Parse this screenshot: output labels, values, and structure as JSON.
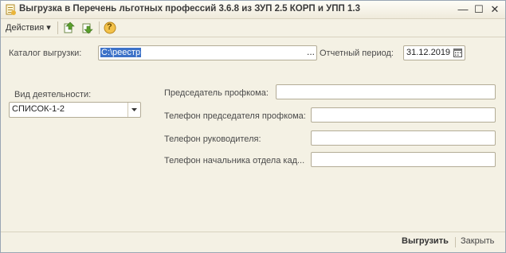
{
  "window": {
    "title": "Выгрузка в Перечень льготных профессий 3.6.8 из ЗУП 2.5 КОРП и УПП 1.3",
    "minimize_glyph": "—",
    "maximize_glyph": "☐",
    "close_glyph": "✕"
  },
  "toolbar": {
    "actions_label": "Действия",
    "actions_arrow": "▾",
    "help_glyph": "?"
  },
  "form": {
    "catalog_label": "Каталог выгрузки:",
    "catalog_value": "C:\\реестр",
    "catalog_browse": "...",
    "period_label": "Отчетный период:",
    "period_value": "31.12.2019",
    "activity_label": "Вид деятельности:",
    "activity_value": "СПИСОК-1-2",
    "chairman_label": "Председатель профкома:",
    "chairman_value": "",
    "chairman_phone_label": "Телефон председателя профкома:",
    "chairman_phone_value": "",
    "head_phone_label": "Телефон руководителя:",
    "head_phone_value": "",
    "hr_phone_label": "Телефон начальника отдела кад...",
    "hr_phone_value": ""
  },
  "footer": {
    "export_label": "Выгрузить",
    "close_label": "Закрыть"
  }
}
